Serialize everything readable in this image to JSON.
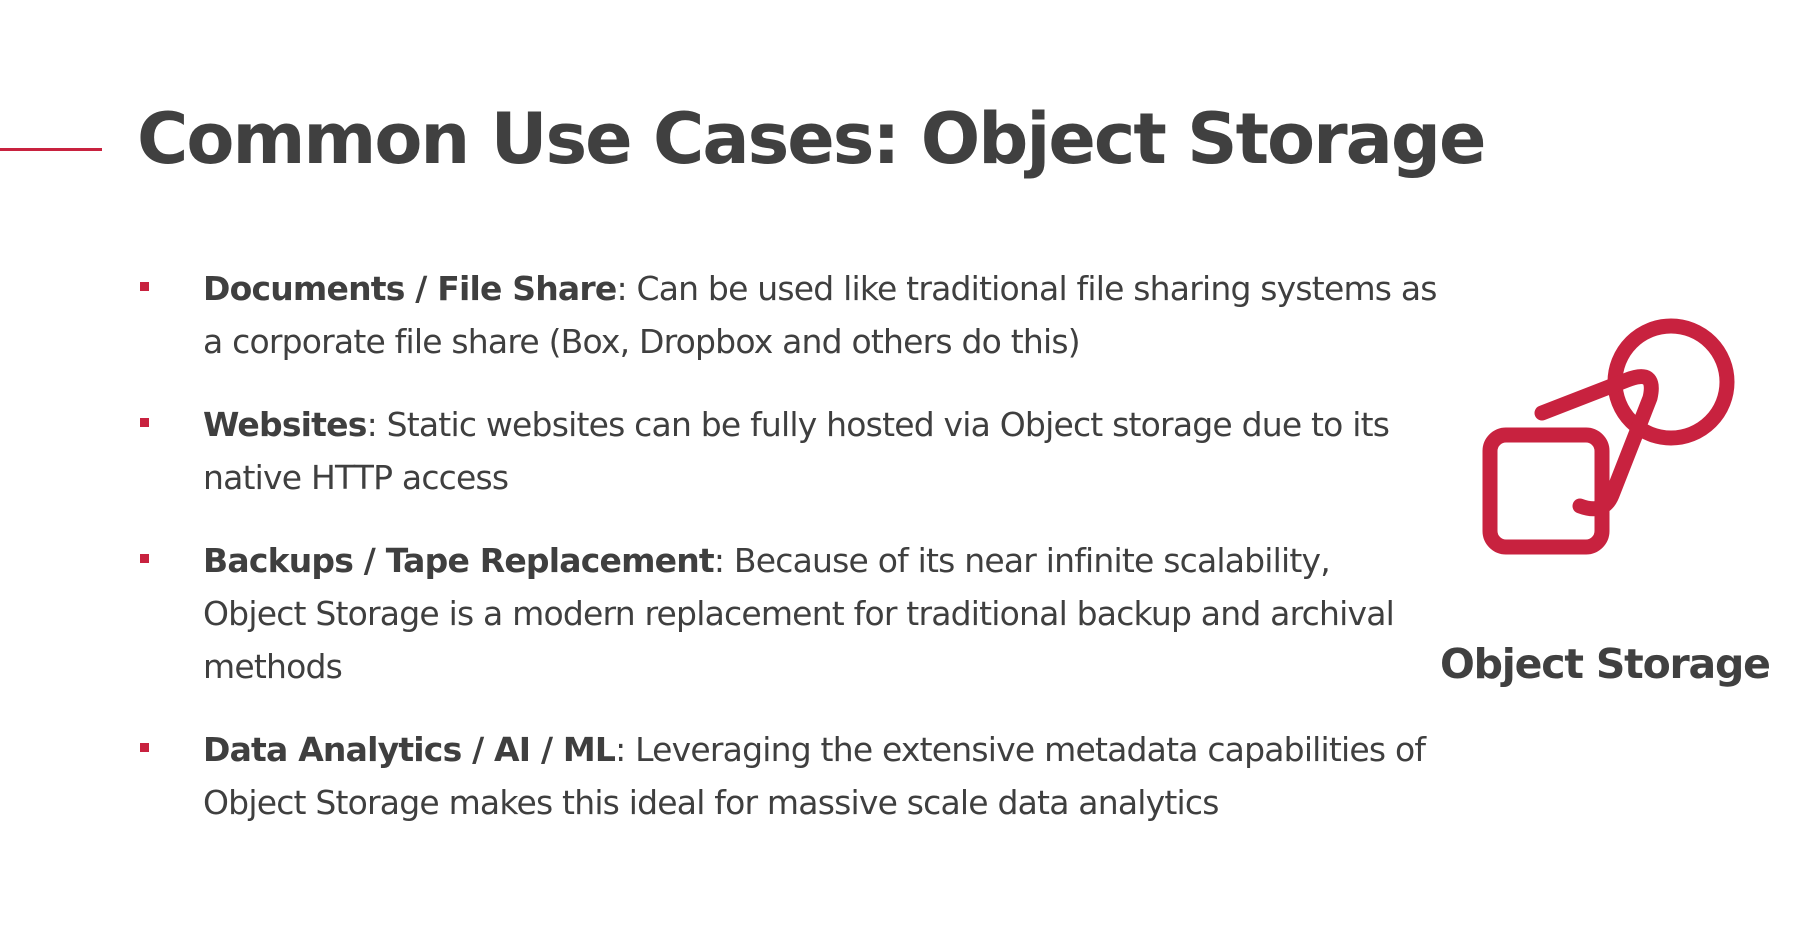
{
  "slide": {
    "title": "Common Use Cases: Object Storage",
    "accent_color": "#c8223f",
    "text_color": "#404040"
  },
  "bullets": [
    {
      "heading": "Documents / File Share",
      "body": ": Can be used like traditional file sharing systems as a corporate file share (Box, Dropbox and others do this)"
    },
    {
      "heading": "Websites",
      "body": ": Static websites can be fully hosted via Object storage due to its native HTTP access"
    },
    {
      "heading": "Backups / Tape Replacement",
      "body": ": Because of its near infinite scalability, Object Storage is a modern replacement for traditional backup and archival methods"
    },
    {
      "heading": "Data Analytics / AI / ML",
      "body": ": Leveraging the extensive metadata capabilities of Object Storage makes this ideal for massive scale data analytics"
    }
  ],
  "illustration": {
    "icon": "object-storage-shapes-icon",
    "label": "Object Storage"
  }
}
